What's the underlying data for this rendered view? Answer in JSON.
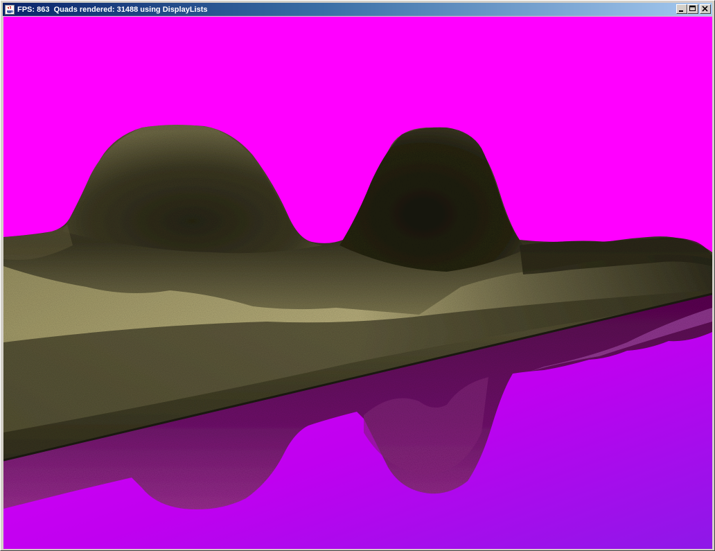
{
  "window": {
    "title": "FPS: 863  Quads rendered: 31488 using DisplayLists",
    "app_icon": "java-cup-icon",
    "buttons": [
      {
        "name": "minimize",
        "icon": "minimize-icon"
      },
      {
        "name": "maximize",
        "icon": "maximize-icon"
      },
      {
        "name": "close",
        "icon": "close-icon"
      }
    ]
  },
  "scene": {
    "sky_color": "#ff00ff",
    "water_color_top": "#d000f0",
    "water_color_bottom": "#9010e8",
    "terrain_light": "#b8ad7a",
    "terrain_dark": "#1e1e14"
  }
}
